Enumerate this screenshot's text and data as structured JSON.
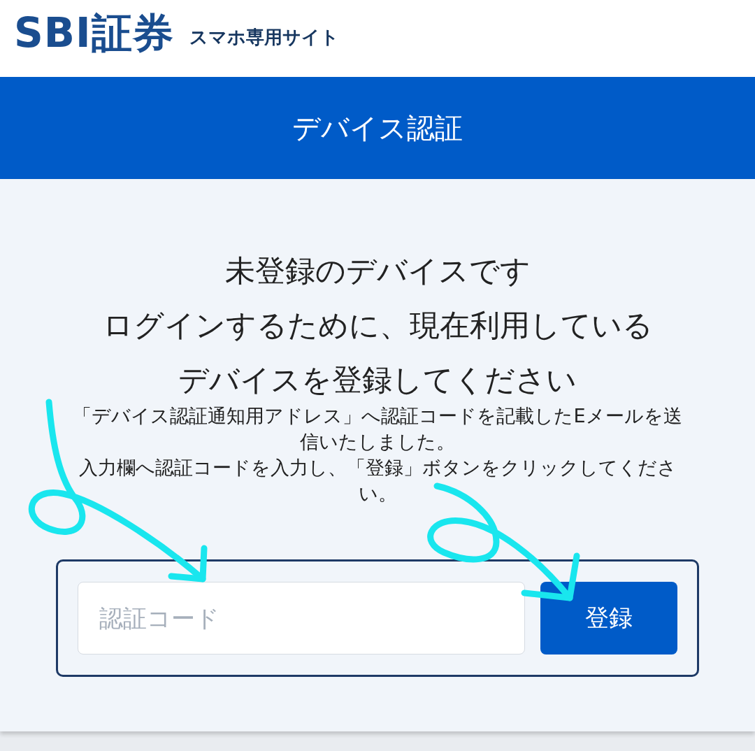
{
  "header": {
    "logo": "SBI証券",
    "subtitle": "スマホ専用サイト"
  },
  "banner": {
    "title": "デバイス認証"
  },
  "headline": [
    "未登録のデバイスです",
    "ログインするために、現在利用している",
    "デバイスを登録してください"
  ],
  "messages": [
    "「デバイス認証通知用アドレス」へ認証コードを記載したEメールを送信いたしました。",
    "入力欄へ認証コードを入力し、「登録」ボタンをクリックしてください。"
  ],
  "form": {
    "code_field": {
      "placeholder": "認証コード"
    },
    "submit_button": "登録"
  }
}
